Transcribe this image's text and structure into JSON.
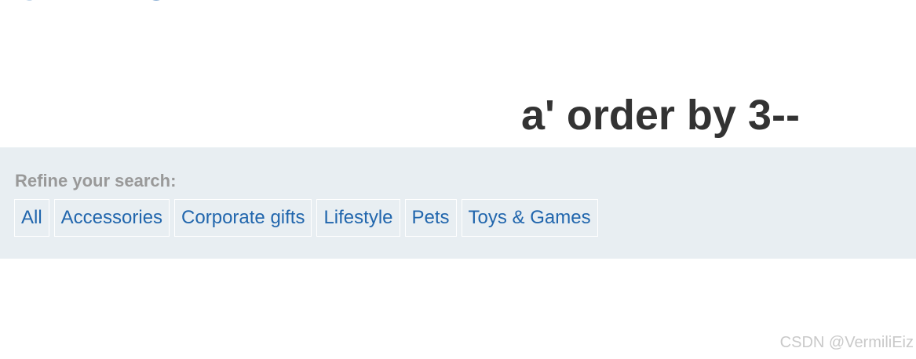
{
  "search": {
    "title": "a' order by 3--"
  },
  "filters": {
    "label": "Refine your search:",
    "items": [
      "All",
      "Accessories",
      "Corporate gifts",
      "Lifestyle",
      "Pets",
      "Toys & Games"
    ]
  },
  "watermark": {
    "text": "CSDN @VermiliEiz"
  },
  "colors": {
    "link": "#2166ad",
    "panel_background": "#e8eef2",
    "title": "#333333"
  },
  "icons": {
    "logo_fragment": "logo-icon"
  }
}
